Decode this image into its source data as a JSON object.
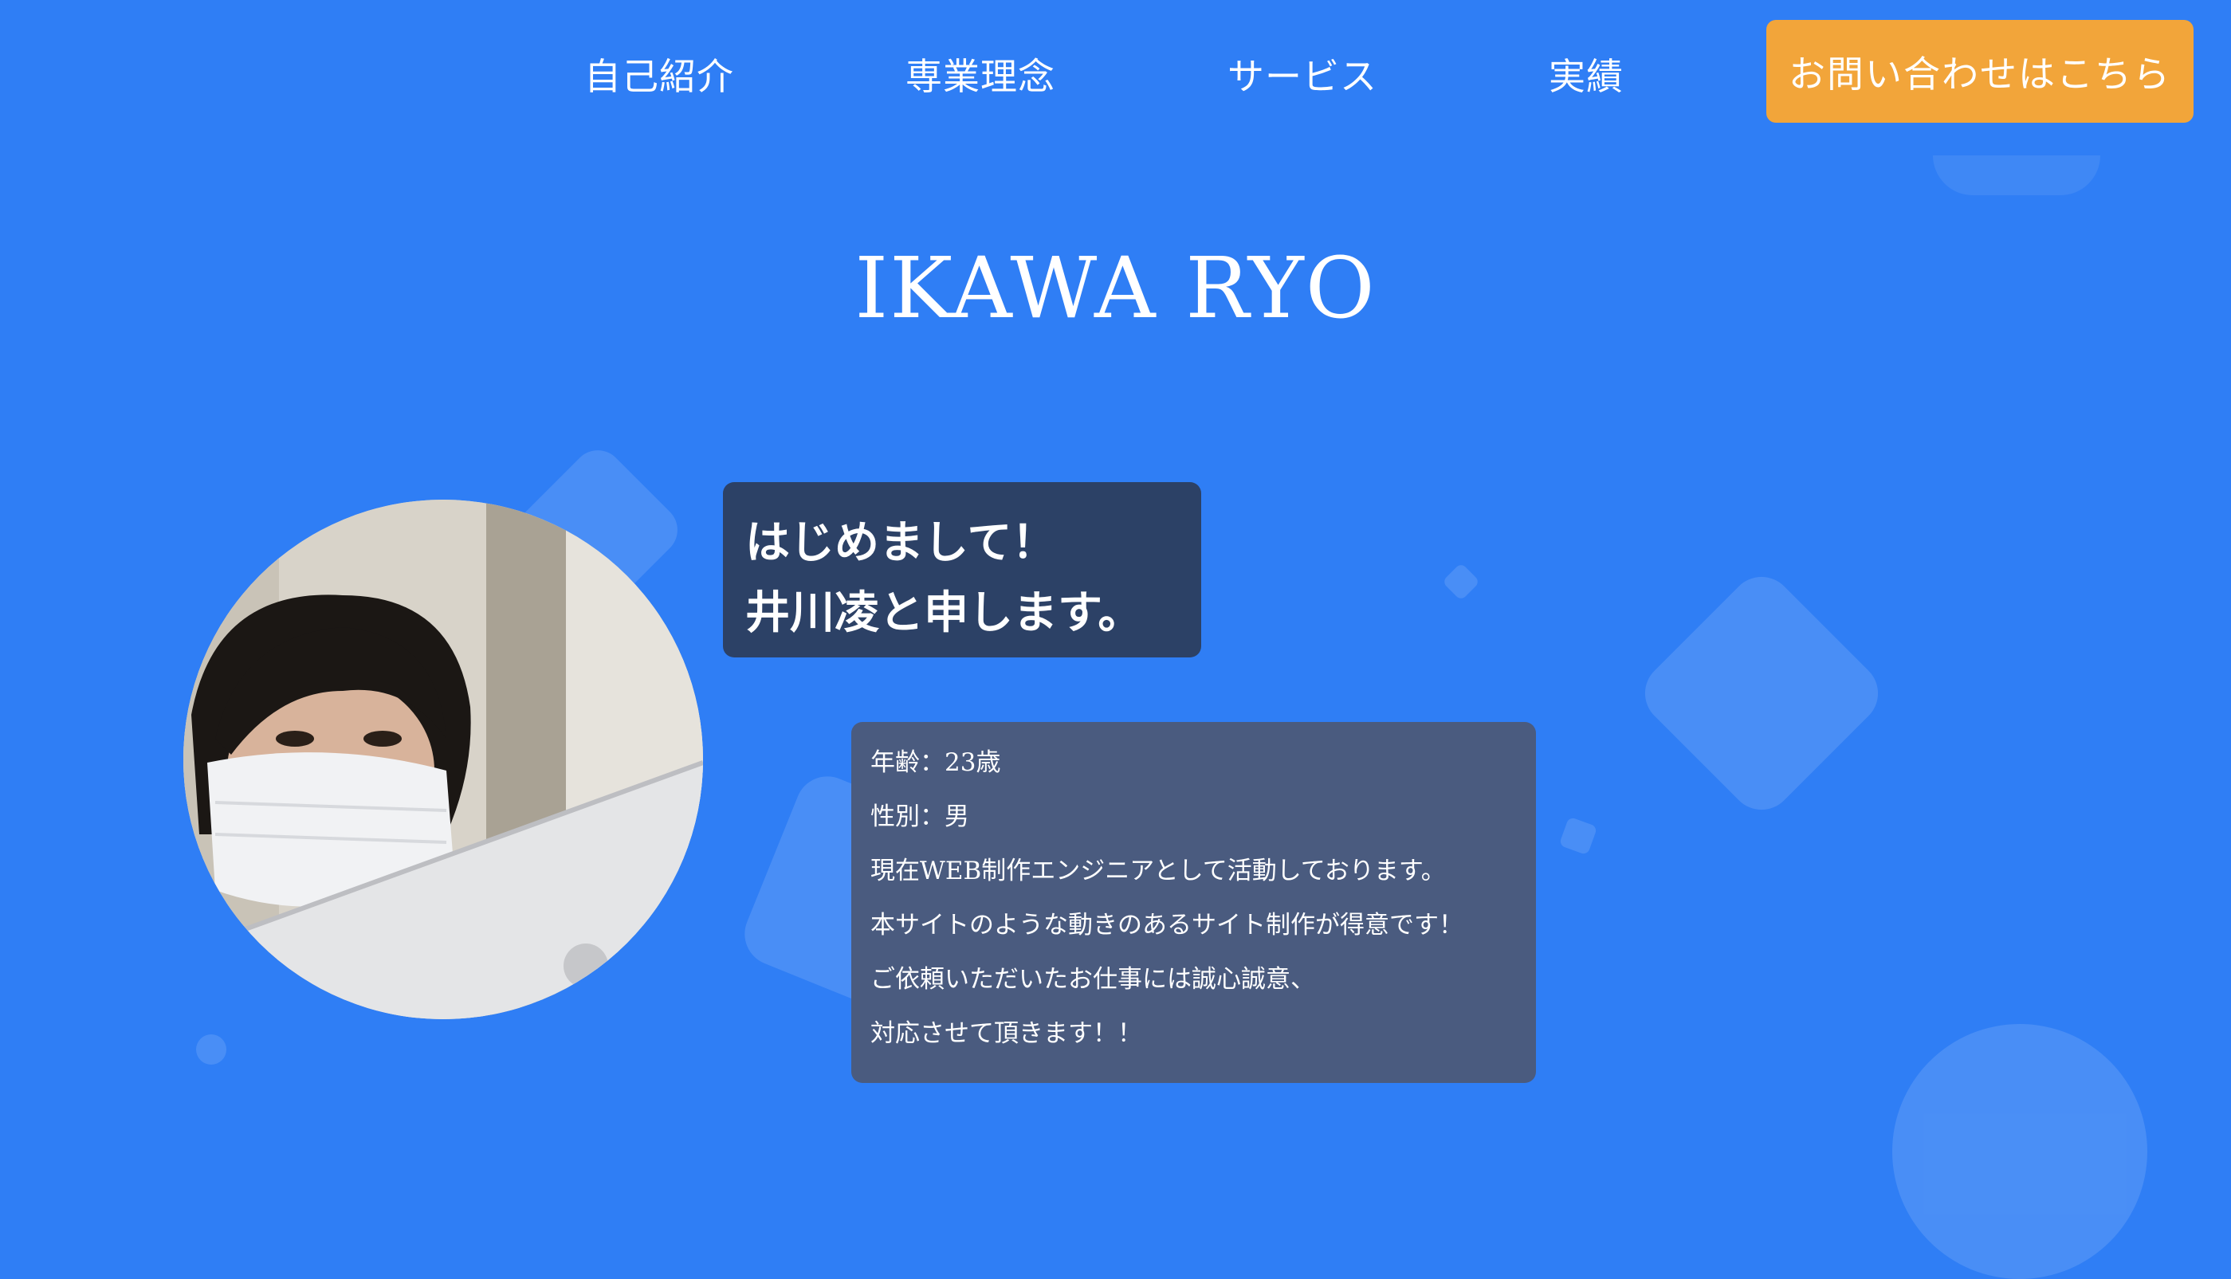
{
  "nav": {
    "items": [
      {
        "label": "自己紹介"
      },
      {
        "label": "専業理念"
      },
      {
        "label": "サービス"
      },
      {
        "label": "実績"
      }
    ],
    "cta_label": "お問い合わせはこちら"
  },
  "hero": {
    "title": "IKAWA RYO"
  },
  "profile": {
    "greeting_lines": [
      "はじめまして！",
      "井川凌と申します。"
    ],
    "details": [
      "年齢：23歳",
      "性別：男",
      "現在WEB制作エンジニアとして活動しております。",
      "本サイトのような動きのあるサイト制作が得意です！",
      "ご依頼いただいたお仕事には誠心誠意、",
      "対応させて頂きます！！"
    ]
  },
  "colors": {
    "background": "#2f7ef5",
    "cta": "#f2a53a",
    "greeting_box": "#2c4166",
    "info_box": "#4a5b7f"
  }
}
